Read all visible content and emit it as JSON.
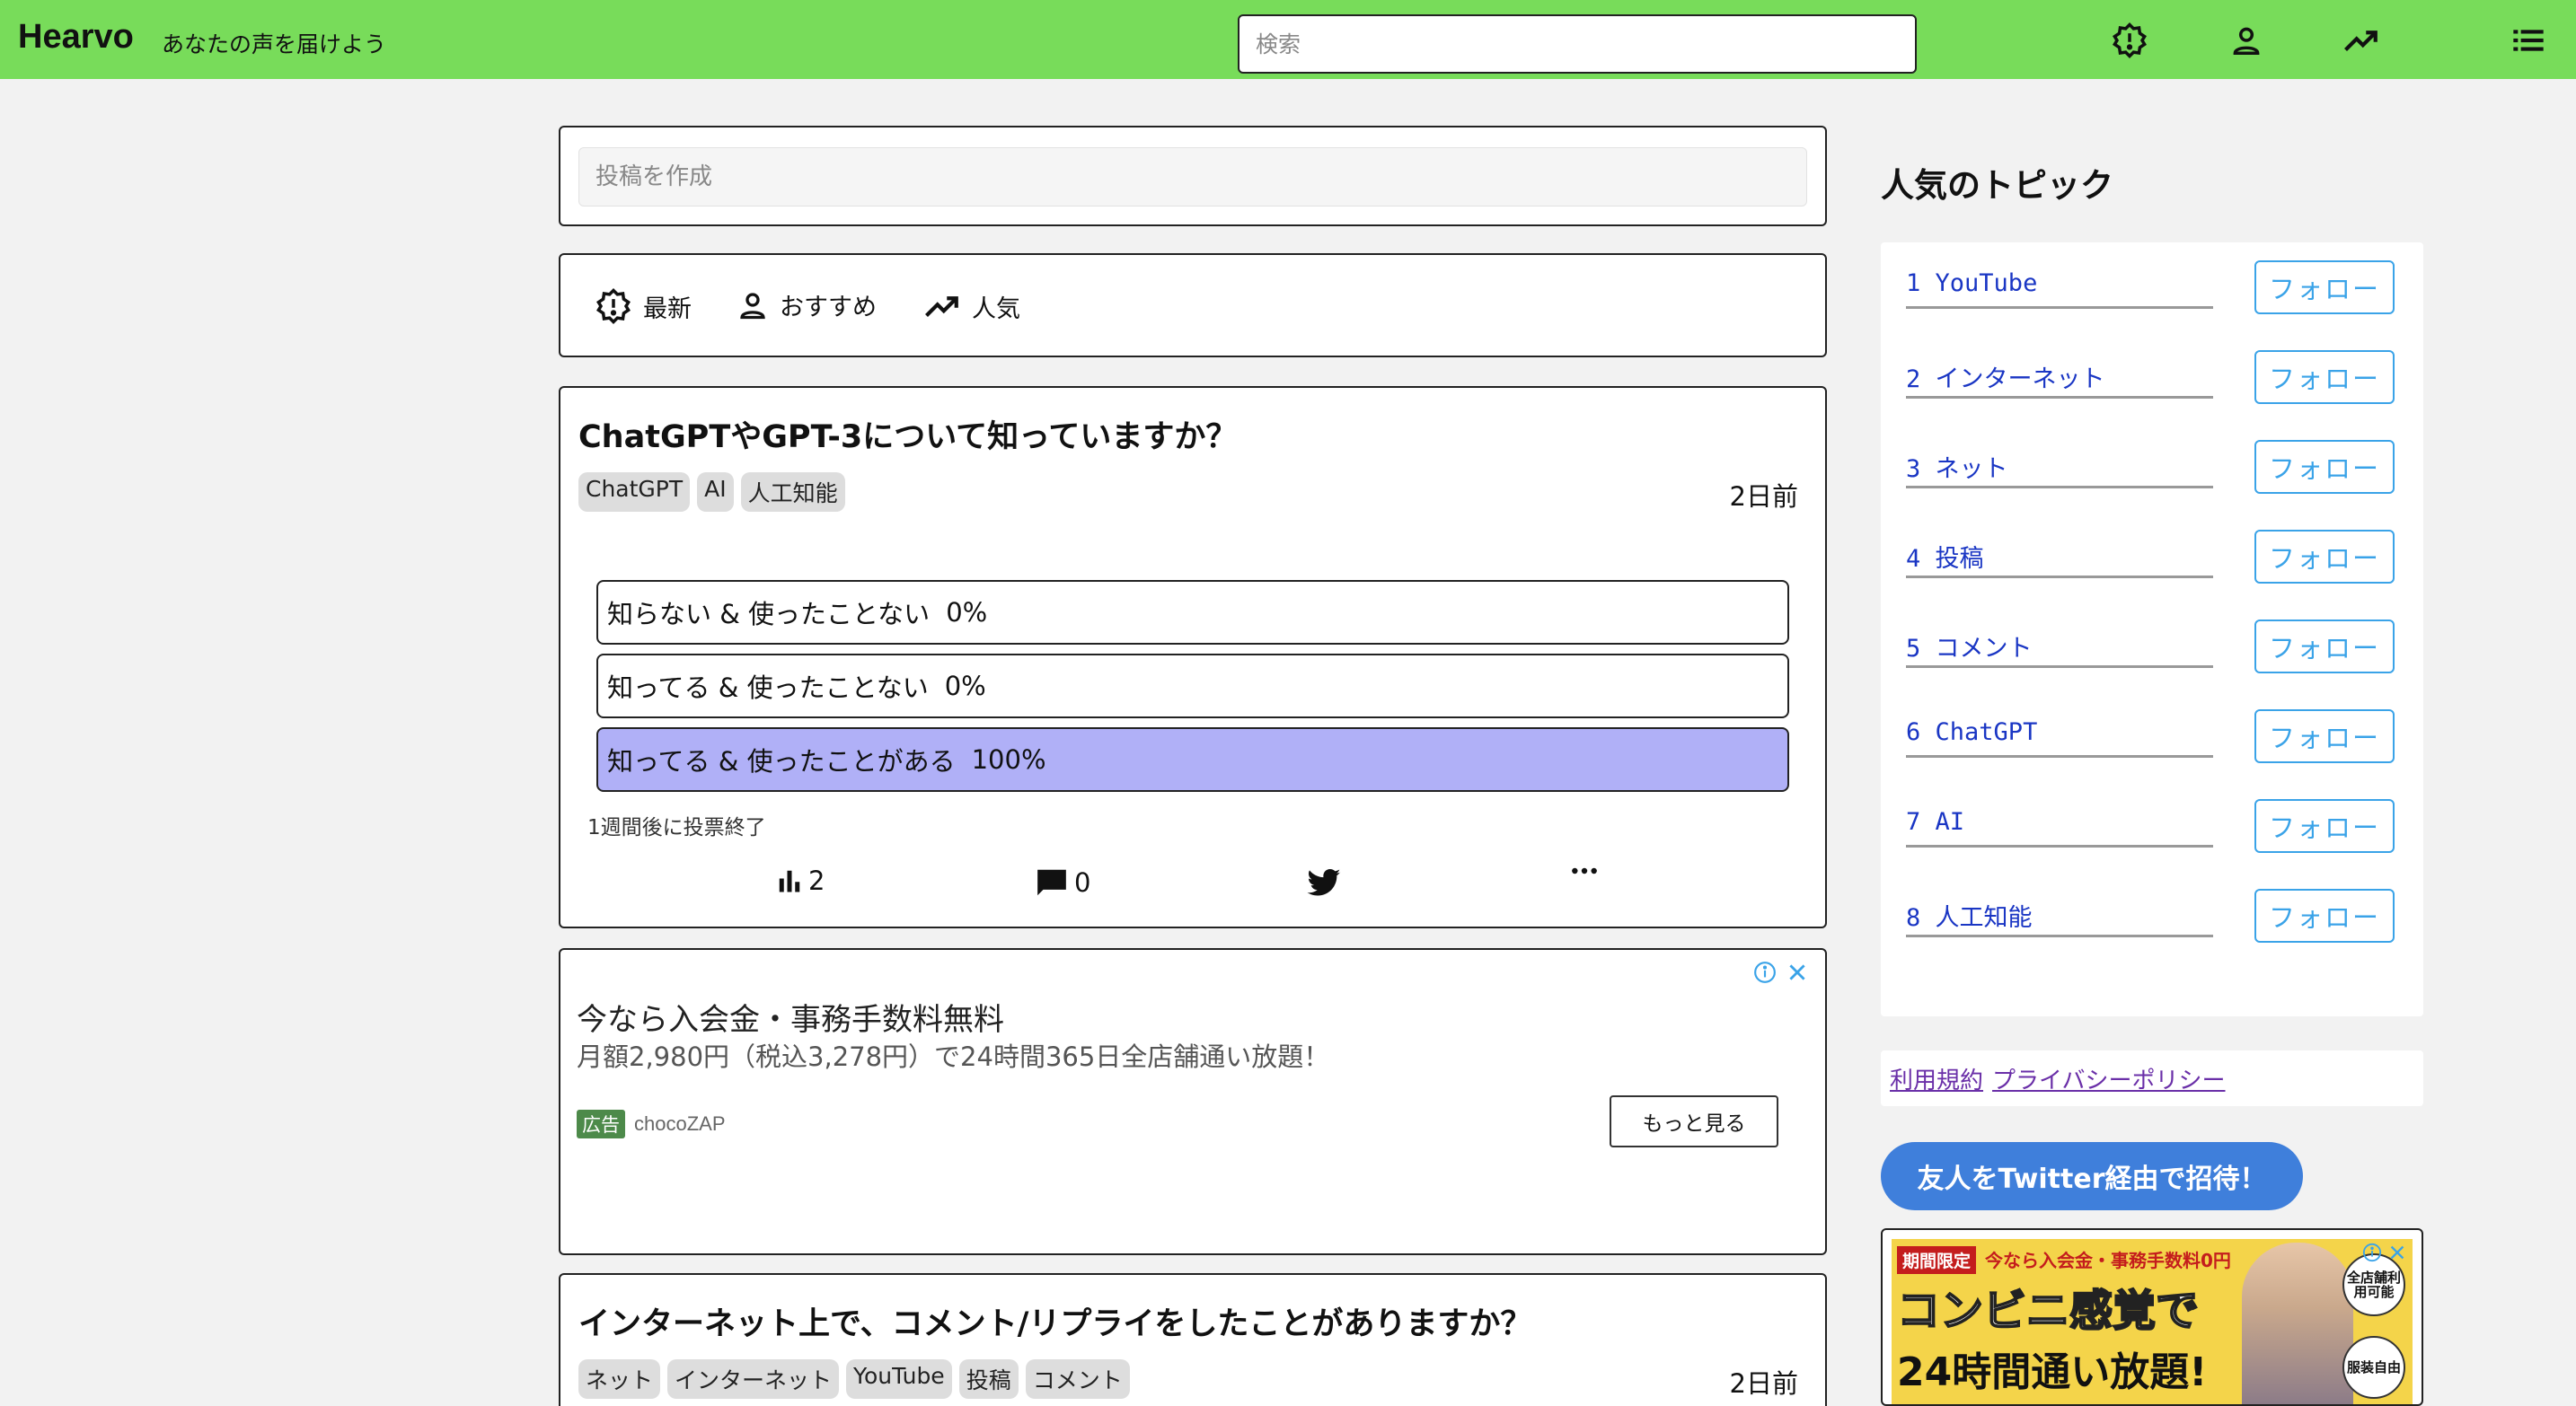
{
  "header": {
    "logo": "Hearvo",
    "tagline": "あなたの声を届けよう",
    "search_placeholder": "検索",
    "icons": [
      "new-alert-icon",
      "user-icon",
      "trending-icon",
      "menu-list-icon"
    ]
  },
  "compose": {
    "placeholder": "投稿を作成"
  },
  "tabs": [
    {
      "label": "最新",
      "icon": "new-alert-icon"
    },
    {
      "label": "おすすめ",
      "icon": "user-icon"
    },
    {
      "label": "人気",
      "icon": "trending-icon"
    }
  ],
  "post1": {
    "title": "ChatGPTやGPT-3について知っていますか？",
    "tags": [
      "ChatGPT",
      "AI",
      "人工知能"
    ],
    "time": "2日前",
    "options": [
      {
        "label": "知らない & 使ったことない",
        "percent": "0%",
        "selected": false
      },
      {
        "label": "知ってる & 使ったことない",
        "percent": "0%",
        "selected": false
      },
      {
        "label": "知ってる & 使ったことがある",
        "percent": "100%",
        "selected": true
      }
    ],
    "vote_end": "1週間後に投票終了",
    "votes": "2",
    "comments": "0"
  },
  "ad1": {
    "headline": "今なら入会金・事務手数料無料",
    "subtext": "月額2,980円（税込3,278円）で24時間365日全店舗通い放題！",
    "label": "広告",
    "source": "chocoZAP",
    "cta": "もっと見る"
  },
  "post2": {
    "title": "インターネット上で、コメント/リプライをしたことがありますか？",
    "tags": [
      "ネット",
      "インターネット",
      "YouTube",
      "投稿",
      "コメント"
    ],
    "time": "2日前"
  },
  "sidebar": {
    "title": "人気のトピック",
    "follow_label": "フォロー",
    "topics": [
      {
        "rank": "1",
        "name": "YouTube"
      },
      {
        "rank": "2",
        "name": "インターネット"
      },
      {
        "rank": "3",
        "name": "ネット"
      },
      {
        "rank": "4",
        "name": "投稿"
      },
      {
        "rank": "5",
        "name": "コメント"
      },
      {
        "rank": "6",
        "name": "ChatGPT"
      },
      {
        "rank": "7",
        "name": "AI"
      },
      {
        "rank": "8",
        "name": "人工知能"
      }
    ],
    "links": [
      "利用規約",
      "プライバシーポリシー"
    ],
    "invite": "友人をTwitter経由で招待！"
  },
  "ad2": {
    "tag": "期間限定",
    "top": "今なら入会金・事務手数料0円",
    "headline1": "コンビニ感覚で",
    "headline2": "24時間通い放題!",
    "badge1": "全店舗利用可能",
    "badge2": "服装自由"
  },
  "colors": {
    "header_bg": "#78dc5a",
    "selected_option": "#b0b0f7",
    "topic_link": "#1a36c4",
    "follow": "#3aa3e8",
    "invite_bg": "#3f7fdb"
  }
}
